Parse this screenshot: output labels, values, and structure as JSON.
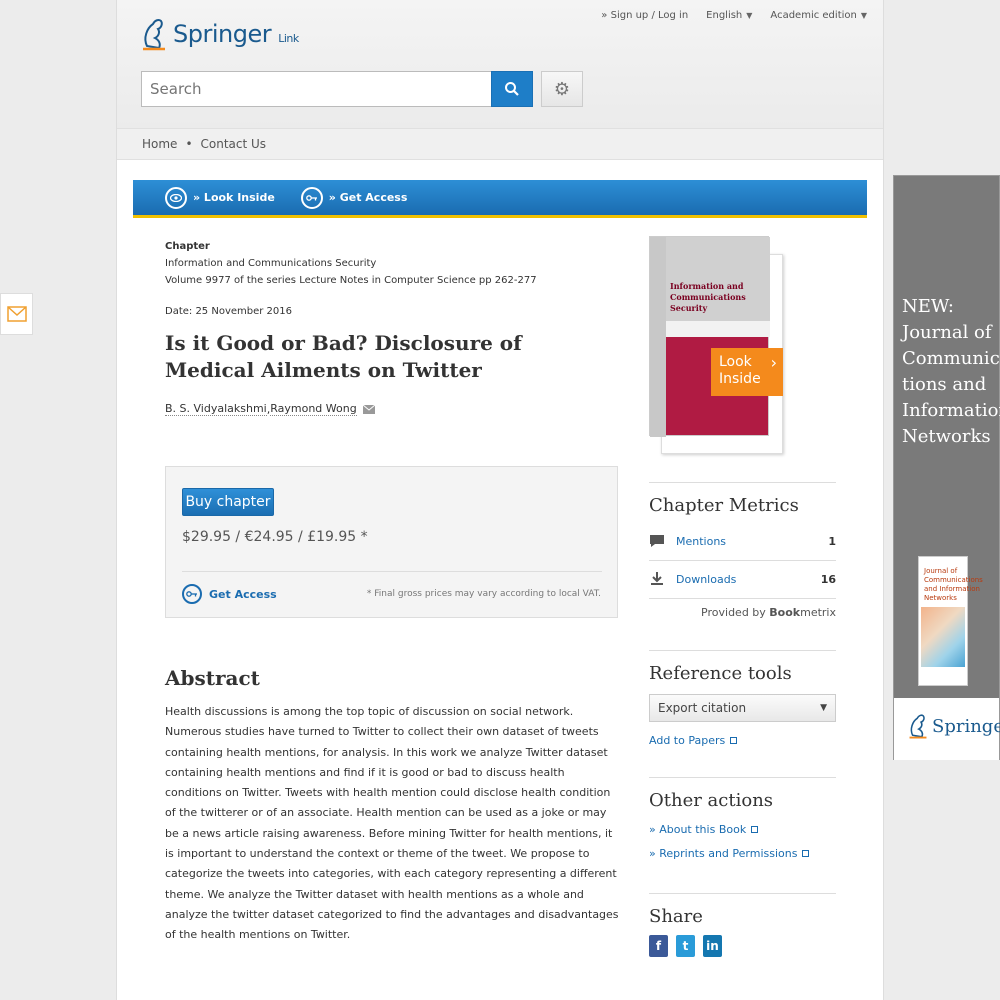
{
  "header": {
    "logo_springer": "Springer",
    "logo_link": "Link",
    "sign_up": "» Sign up / Log in",
    "language": "English",
    "edition": "Academic edition",
    "search_placeholder": "Search"
  },
  "breadcrumb": {
    "home": "Home",
    "contact": "Contact Us"
  },
  "action_bar": {
    "look_inside": "» Look Inside",
    "get_access": "» Get Access"
  },
  "meta": {
    "kind": "Chapter",
    "book": "Information and Communications Security",
    "series": "Volume 9977 of the series Lecture Notes in Computer Science pp 262-277",
    "date": "Date: 25 November 2016"
  },
  "title": "Is it Good or Bad? Disclosure of Medical Ailments on Twitter",
  "authors": {
    "a1": "B. S. Vidyalakshmi",
    "sep": ", ",
    "a2": "Raymond Wong"
  },
  "buy": {
    "button": "Buy chapter",
    "price": "$29.95 / €24.95 / £19.95 *",
    "get_access": "Get Access",
    "vat_note": "* Final gross prices may vary according to local VAT."
  },
  "abstract": {
    "heading": "Abstract",
    "text": "Health discussions is among the top topic of discussion on social network. Numerous studies have turned to Twitter to collect their own dataset of tweets containing health mentions, for analysis. In this work we analyze Twitter dataset containing health mentions and find if it is good or bad to discuss health conditions on Twitter. Tweets with health mention could disclose health condition of the twitterer or of an associate. Health mention can be used as a joke or may be a news article raising awareness. Before mining Twitter for health mentions, it is important to understand the context or theme of the tweet. We propose to categorize the tweets into categories, with each category representing a different theme. We analyze the Twitter dataset with health mentions as a whole and analyze the twitter dataset categorized to find the advantages and disadvantages of the health mentions on Twitter."
  },
  "cover": {
    "title_line1": "Information and",
    "title_line2": "Communications",
    "title_line3": "Security",
    "look_inside_1": "Look",
    "look_inside_2": "Inside"
  },
  "metrics": {
    "heading": "Chapter Metrics",
    "mentions_label": "Mentions",
    "mentions_value": "1",
    "downloads_label": "Downloads",
    "downloads_value": "16",
    "provided_prefix": "Provided by ",
    "provided_brand_bold": "Book",
    "provided_brand_rest": "metrix"
  },
  "reference_tools": {
    "heading": "Reference tools",
    "export": "Export citation",
    "add_to_papers": "Add to Papers"
  },
  "other_actions": {
    "heading": "Other actions",
    "about": "» About this Book",
    "reprints": "» Reprints and Permissions"
  },
  "share": {
    "heading": "Share"
  },
  "ad": {
    "text_1": "NEW:",
    "text_2": "Journal of",
    "text_3": "Communica-",
    "text_4": "tions and",
    "text_5": "Information",
    "text_6": "Networks",
    "cover_title": "Journal of Communications and Information Networks",
    "logo": "Springer"
  },
  "colors": {
    "brand_blue": "#1a6cb0",
    "accent_orange": "#f48a1c",
    "cover_red": "#b01b43"
  }
}
